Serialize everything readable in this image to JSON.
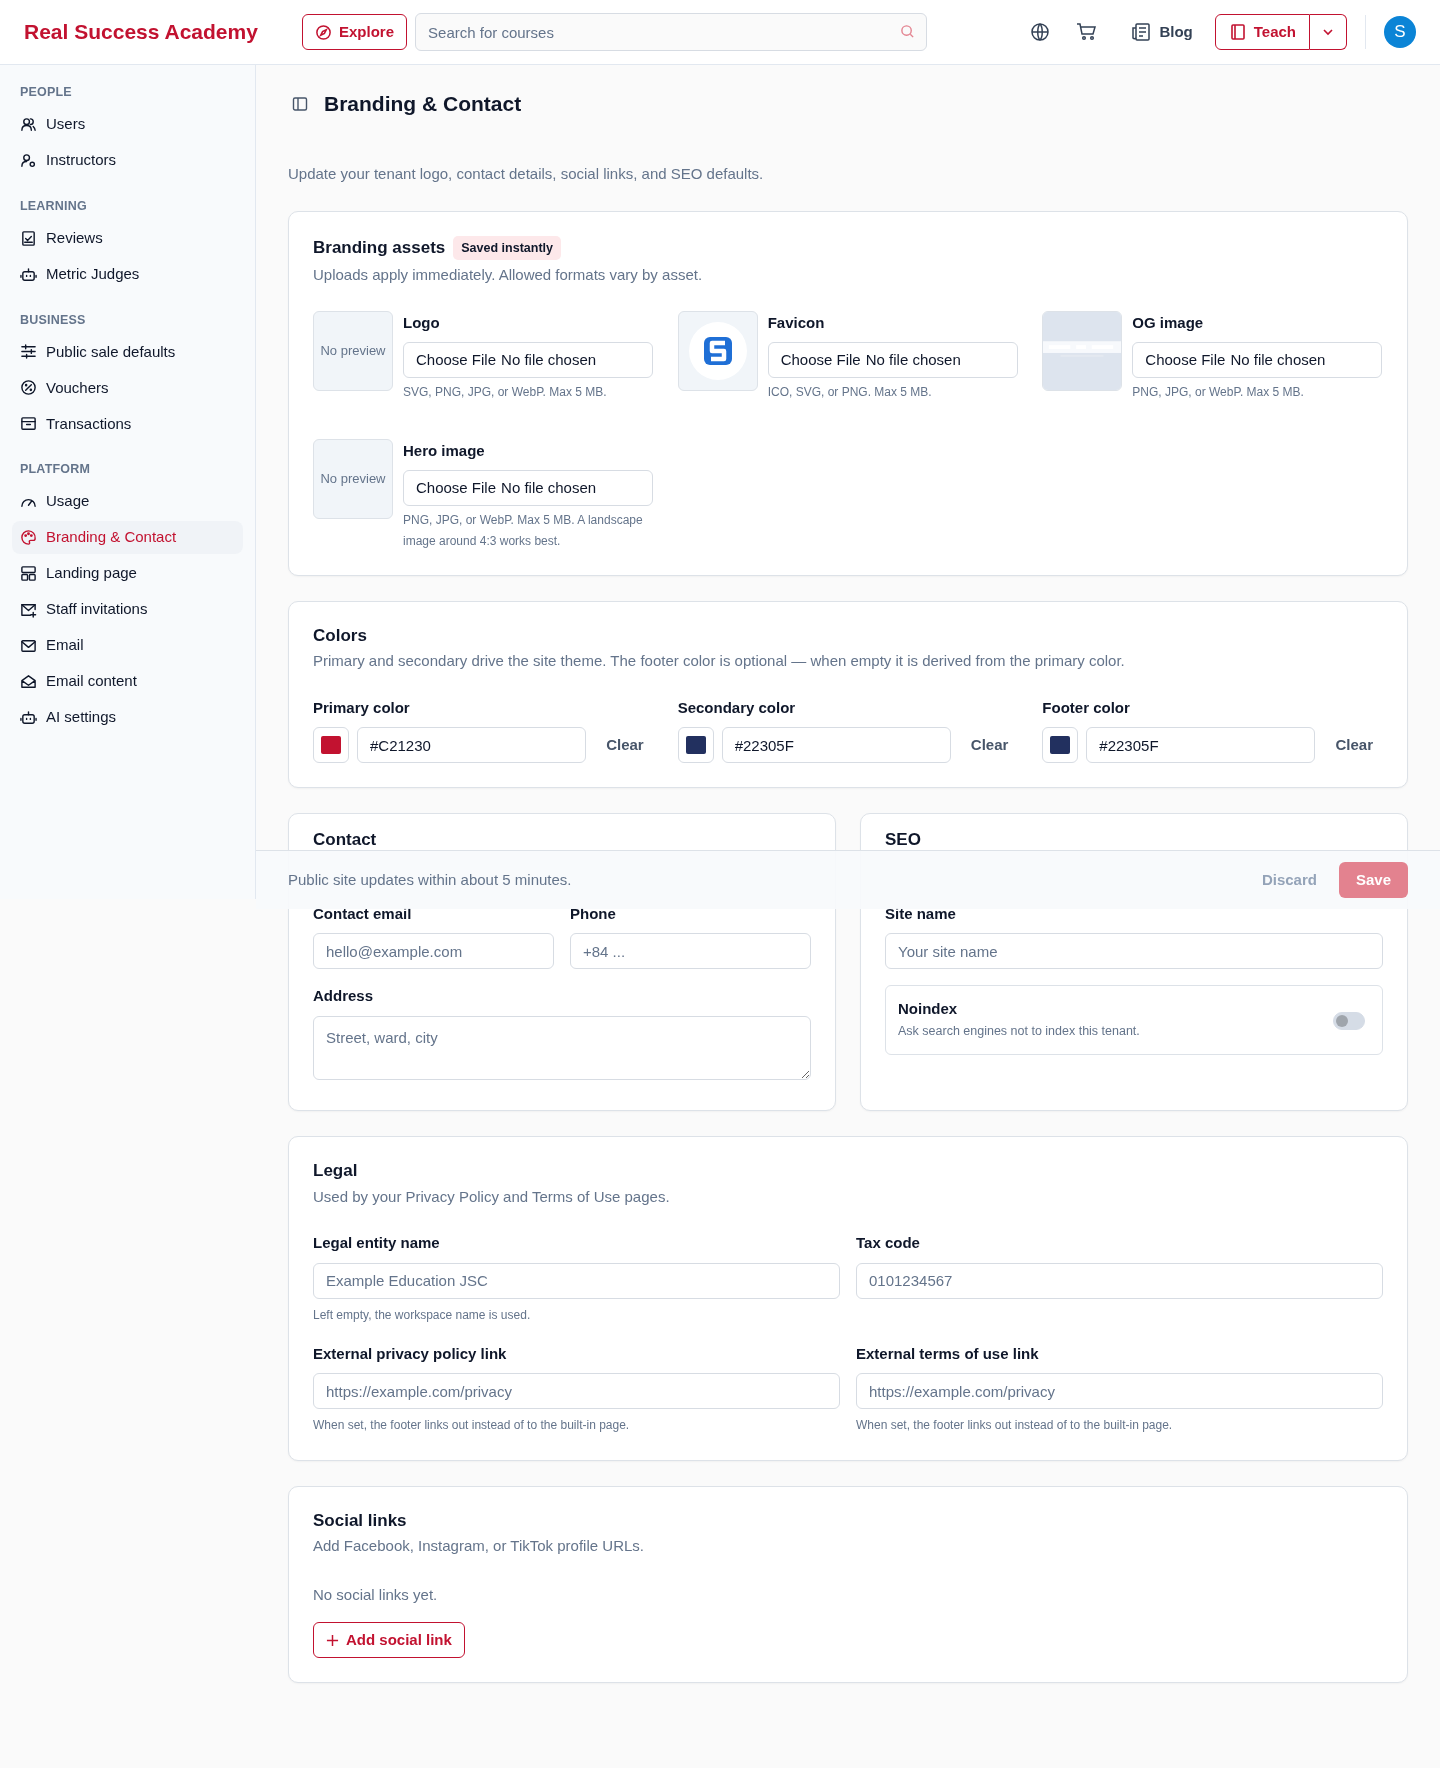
{
  "header": {
    "brand": "Real Success Academy",
    "explore": "Explore",
    "search_placeholder": "Search for courses",
    "blog": "Blog",
    "teach": "Teach",
    "avatar": "S"
  },
  "sidebar": {
    "sections": [
      {
        "title": "PEOPLE",
        "items": [
          {
            "label": "Users",
            "selected": false
          },
          {
            "label": "Instructors",
            "selected": false
          }
        ]
      },
      {
        "title": "LEARNING",
        "items": [
          {
            "label": "Reviews",
            "selected": false
          },
          {
            "label": "Metric Judges",
            "selected": false
          }
        ]
      },
      {
        "title": "BUSINESS",
        "items": [
          {
            "label": "Public sale defaults",
            "selected": false
          },
          {
            "label": "Vouchers",
            "selected": false
          },
          {
            "label": "Transactions",
            "selected": false
          }
        ]
      },
      {
        "title": "PLATFORM",
        "items": [
          {
            "label": "Usage",
            "selected": false
          },
          {
            "label": "Branding & Contact",
            "selected": true
          },
          {
            "label": "Landing page",
            "selected": false
          },
          {
            "label": "Staff invitations",
            "selected": false
          },
          {
            "label": "Email",
            "selected": false
          },
          {
            "label": "Email content",
            "selected": false
          },
          {
            "label": "AI settings",
            "selected": false
          }
        ]
      }
    ]
  },
  "page": {
    "title": "Branding & Contact",
    "subtitle": "Update your tenant logo, contact details, social links, and SEO defaults."
  },
  "branding": {
    "title": "Branding assets",
    "badge": "Saved instantly",
    "description": "Uploads apply immediately. Allowed formats vary by asset.",
    "assets": [
      {
        "label": "Logo",
        "kind": "placeholder",
        "preview_text": "No preview",
        "file_button": "Choose File",
        "file_status": "No file chosen",
        "hint": "SVG, PNG, JPG, or WebP. Max 5 MB."
      },
      {
        "label": "Favicon",
        "kind": "logo",
        "file_button": "Choose File",
        "file_status": "No file chosen",
        "hint": "ICO, SVG, or PNG. Max 5 MB."
      },
      {
        "label": "OG image",
        "kind": "picture",
        "file_button": "Choose File",
        "file_status": "No file chosen",
        "hint": "PNG, JPG, or WebP. Max 5 MB."
      },
      {
        "label": "Hero image",
        "kind": "placeholder",
        "preview_text": "No preview",
        "file_button": "Choose File",
        "file_status": "No file chosen",
        "hint": "PNG, JPG, or WebP. Max 5 MB. A landscape image around 4:3 works best."
      }
    ]
  },
  "colors": {
    "title": "Colors",
    "description": "Primary and secondary drive the site theme. The footer color is optional — when empty it is derived from the primary color.",
    "fields": [
      {
        "label": "Primary color",
        "color": "#c21230",
        "value": "#C21230",
        "clear": "Clear"
      },
      {
        "label": "Secondary color",
        "color": "#22305f",
        "value": "#22305F",
        "clear": "Clear"
      },
      {
        "label": "Footer color",
        "color": "#22305f",
        "value": "#22305F",
        "clear": "Clear"
      }
    ]
  },
  "contact": {
    "title": "Contact",
    "email": {
      "label": "Contact email",
      "placeholder": "hello@example.com"
    },
    "phone": {
      "label": "Phone",
      "placeholder": "+84 ..."
    },
    "address": {
      "label": "Address",
      "placeholder": "Street, ward, city"
    }
  },
  "seo": {
    "title": "SEO",
    "site_name": {
      "label": "Site name",
      "placeholder": "Your site name"
    },
    "noindex": {
      "title": "Noindex",
      "description": "Ask search engines not to index this tenant.",
      "on": false
    }
  },
  "legal": {
    "title": "Legal",
    "description": "Used by your Privacy Policy and Terms of Use pages.",
    "fields": [
      {
        "label": "Legal entity name",
        "placeholder": "Example Education JSC",
        "help": "Left empty, the workspace name is used."
      },
      {
        "label": "Tax code",
        "placeholder": "0101234567"
      },
      {
        "label": "External privacy policy link",
        "placeholder": "https://example.com/privacy",
        "help": "When set, the footer links out instead of to the built-in page."
      },
      {
        "label": "External terms of use link",
        "placeholder": "https://example.com/privacy",
        "help": "When set, the footer links out instead of to the built-in page."
      }
    ]
  },
  "social": {
    "title": "Social links",
    "description": "Add Facebook, Instagram, or TikTok profile URLs.",
    "empty": "No social links yet.",
    "add": "Add social link"
  },
  "save_bar": {
    "text": "Public site updates within about 5 minutes.",
    "discard": "Discard",
    "save": "Save",
    "save_disabled": true
  }
}
